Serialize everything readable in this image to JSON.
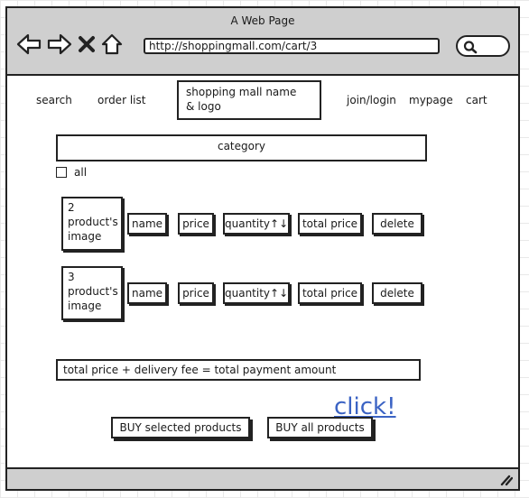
{
  "window": {
    "title": "A Web Page"
  },
  "browser": {
    "url": "http://shoppingmall.com/cart/3"
  },
  "nav_icons": [
    "arrow-left-icon",
    "arrow-right-icon",
    "close-icon",
    "home-icon"
  ],
  "menu": {
    "search": "search",
    "order_list": "order list",
    "logo_line1": "shopping mall name",
    "logo_line2": "& logo",
    "join_login": "join/login",
    "mypage": "mypage",
    "cart": "cart"
  },
  "category": {
    "label": "category"
  },
  "select_all": {
    "label": "all",
    "checked": false
  },
  "cart_items": [
    {
      "image_lines": [
        "2",
        "product's",
        "image"
      ],
      "name": "name",
      "price": "price",
      "quantity": "quantity↑↓",
      "total_price": "total price",
      "delete": "delete"
    },
    {
      "image_lines": [
        "3",
        "product's",
        "image"
      ],
      "name": "name",
      "price": "price",
      "quantity": "quantity↑↓",
      "total_price": "total price",
      "delete": "delete"
    }
  ],
  "summary": {
    "text": "total price + delivery fee = total payment amount"
  },
  "annotation": {
    "click": "click!"
  },
  "actions": {
    "buy_selected": "BUY selected products",
    "buy_all": "BUY all products"
  },
  "colors": {
    "chrome": "#cfcfcf",
    "link": "#3b63c4",
    "stroke": "#222222"
  }
}
